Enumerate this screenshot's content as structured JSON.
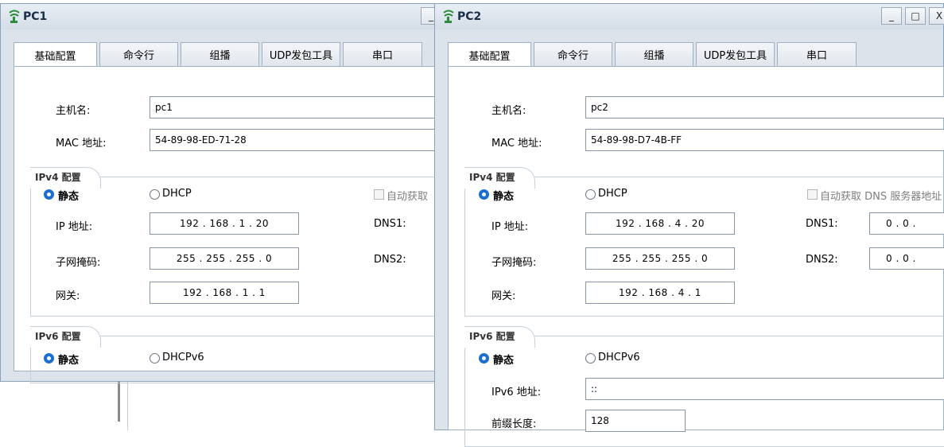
{
  "pc1": {
    "title": "PC1",
    "controls": [
      "_"
    ],
    "tabs": [
      "基础配置",
      "命令行",
      "组播",
      "UDP发包工具",
      "串口"
    ],
    "hostname_label": "主机名:",
    "hostname": "pc1",
    "mac_label": "MAC 地址:",
    "mac": "54-89-98-ED-71-28",
    "ipv4_section": "IPv4 配置",
    "static_label": "静态",
    "dhcp_label": "DHCP",
    "auto_dns_label": "自动获取",
    "ip_label": "IP 地址:",
    "ip": "192 . 168 .  1  .  20",
    "mask_label": "子网掩码:",
    "mask": "255 . 255 . 255 .  0",
    "gw_label": "网关:",
    "gw": "192 . 168 .  1  .  1",
    "dns1_label": "DNS1:",
    "dns2_label": "DNS2:",
    "ipv6_section": "IPv6 配置",
    "static6_label": "静态",
    "dhcpv6_label": "DHCPv6"
  },
  "pc2": {
    "title": "PC2",
    "controls": [
      "_",
      "□",
      "X"
    ],
    "tabs": [
      "基础配置",
      "命令行",
      "组播",
      "UDP发包工具",
      "串口"
    ],
    "hostname_label": "主机名:",
    "hostname": "pc2",
    "mac_label": "MAC 地址:",
    "mac": "54-89-98-D7-4B-FF",
    "ipv4_section": "IPv4 配置",
    "static_label": "静态",
    "dhcp_label": "DHCP",
    "auto_dns_label": "自动获取 DNS 服务器地址",
    "ip_label": "IP 地址:",
    "ip": "192 . 168 .  4  .  20",
    "mask_label": "子网掩码:",
    "mask": "255 . 255 . 255 .  0",
    "gw_label": "网关:",
    "gw": "192 . 168 .  4  .  1",
    "dns1_label": "DNS1:",
    "dns1": "0  .  0  .",
    "dns2_label": "DNS2:",
    "dns2": "0  .  0  .",
    "ipv6_section": "IPv6 配置",
    "static6_label": "静态",
    "dhcpv6_label": "DHCPv6",
    "ipv6_label": "IPv6 地址:",
    "ipv6": "::",
    "prefix_label": "前缀长度:",
    "prefix": "128"
  },
  "colors": {
    "radio_accent": "#1a6fd0",
    "window_bg": "#dde3ea"
  }
}
